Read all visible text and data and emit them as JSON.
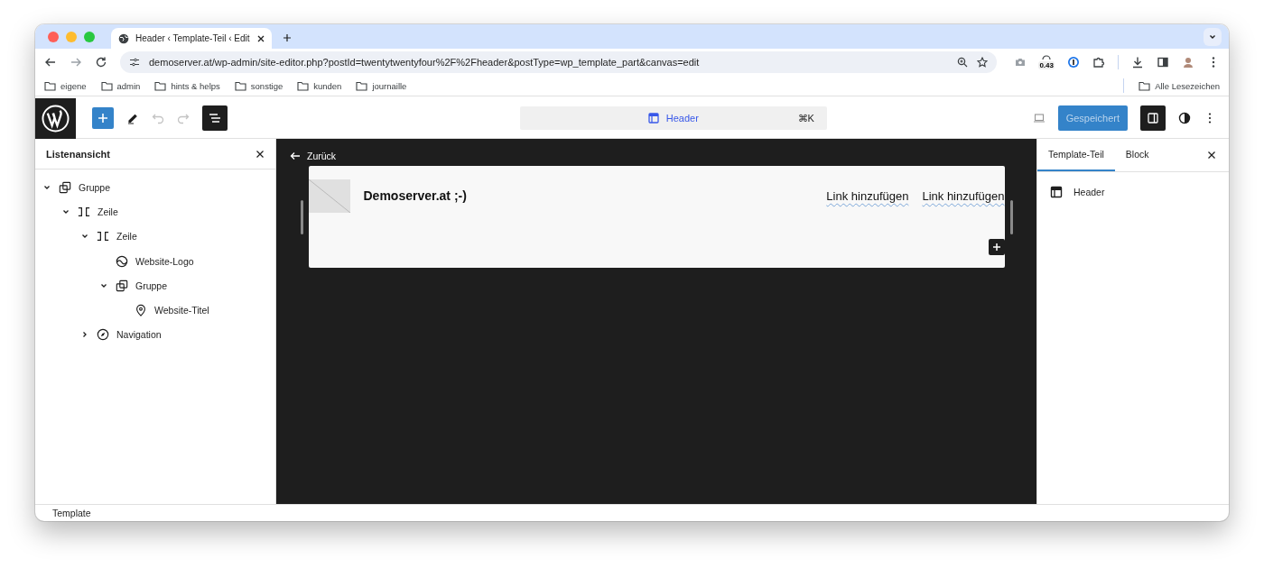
{
  "browser": {
    "tab": {
      "title": "Header ‹ Template-Teil ‹ Edit"
    },
    "url": "demoserver.at/wp-admin/site-editor.php?postId=twentytwentyfour%2F%2Fheader&postType=wp_template_part&canvas=edit",
    "extension_badge": "0.43",
    "bookmarks": [
      "eigene",
      "admin",
      "hints & helps",
      "sonstige",
      "kunden",
      "journaille"
    ],
    "all_bookmarks": "Alle Lesezeichen"
  },
  "toolbar": {
    "undo_disabled": true,
    "redo_disabled": true,
    "list_view_selected": true,
    "document_title": "Header",
    "shortcut": "⌘K",
    "save_button": "Gespeichert",
    "settings_selected": true
  },
  "list_view": {
    "title": "Listenansicht",
    "tree": [
      {
        "label": "Gruppe",
        "kind": "group",
        "expanded": true,
        "children": [
          {
            "label": "Zeile",
            "kind": "row",
            "expanded": true,
            "children": [
              {
                "label": "Zeile",
                "kind": "row",
                "expanded": true,
                "children": [
                  {
                    "label": "Website-Logo",
                    "kind": "logo"
                  },
                  {
                    "label": "Gruppe",
                    "kind": "group",
                    "expanded": true,
                    "children": [
                      {
                        "label": "Website-Titel",
                        "kind": "title"
                      }
                    ]
                  }
                ]
              },
              {
                "label": "Navigation",
                "kind": "navigation",
                "expanded": false
              }
            ]
          }
        ]
      }
    ]
  },
  "canvas": {
    "back": "Zurück",
    "site_title": "Demoserver.at ;-)",
    "nav_links": [
      "Link hinzufügen",
      "Link hinzufügen"
    ]
  },
  "inspector": {
    "tabs": [
      {
        "label": "Template-Teil",
        "selected": true
      },
      {
        "label": "Block",
        "selected": false
      }
    ],
    "item": "Header"
  },
  "status_bar": "Template"
}
